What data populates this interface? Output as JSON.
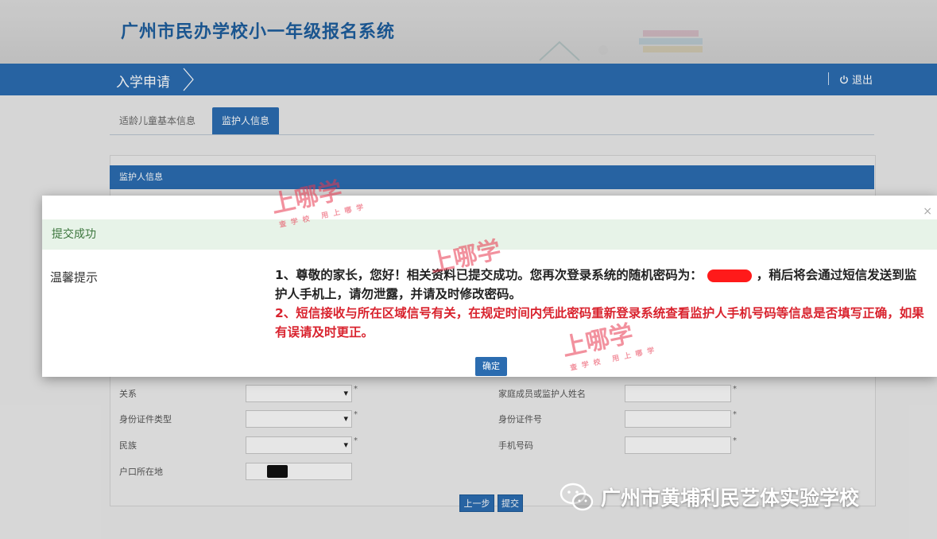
{
  "header": {
    "system_title": "广州市民办学校小一年级报名系统"
  },
  "nav": {
    "breadcrumb": "入学申请",
    "logout": "退出"
  },
  "tabs": [
    {
      "label": "适龄儿童基本信息"
    },
    {
      "label": "监护人信息"
    }
  ],
  "panel": {
    "title": "监护人信息"
  },
  "form": {
    "relation_label": "关系",
    "guardian_name_label": "家庭成员或监护人姓名",
    "id_type_label": "身份证件类型",
    "id_number_label": "身份证件号",
    "ethnicity_label": "民族",
    "phone_label": "手机号码",
    "hukou_label": "户口所在地",
    "required_mark": "*"
  },
  "buttons": {
    "prev": "上一步",
    "submit": "提交"
  },
  "modal": {
    "close": "×",
    "status": "提交成功",
    "tip_label": "温馨提示",
    "line1_a": "1、尊敬的家长，您好！相关资料已提交成功。您再次登录系统的随机密码为：",
    "line1_b": "，稍后将会通过短信发送到监护人手机上，请勿泄露，并请及时修改密码。",
    "line2": "2、短信接收与所在区域信号有关，在规定时间内凭此密码重新登录系统查看监护人手机号码等信息是否填写正确，如果有误请及时更正。",
    "ok": "确定"
  },
  "watermark": {
    "brand": "上哪学",
    "slogan": "查学校 用上哪学"
  },
  "footer": {
    "wechat_account": "广州市黄埔利民艺体实验学校"
  },
  "colors": {
    "primary": "#2b6cb0",
    "success_bg": "#e7f3e8",
    "success_text": "#3c763d",
    "warning_text": "#d9232e"
  }
}
